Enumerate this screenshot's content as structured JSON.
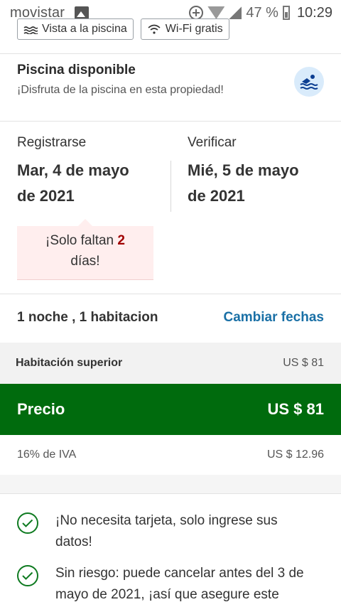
{
  "status_bar": {
    "carrier": "movistar",
    "battery_percent": "47 %",
    "time": "10:29"
  },
  "amenities": [
    {
      "label": "Vista a la piscina",
      "icon": "pool-icon"
    },
    {
      "label": "Wi-Fi gratis",
      "icon": "wifi-icon"
    }
  ],
  "pool": {
    "title": "Piscina disponible",
    "subtitle": "¡Disfruta de la piscina en esta propiedad!",
    "icon": "swimmer-icon"
  },
  "checkin": {
    "label": "Registrarse",
    "line1": "Mar, 4 de mayo",
    "line2": "de 2021"
  },
  "checkout": {
    "label": "Verificar",
    "line1": "Mié, 5 de mayo",
    "line2": "de 2021"
  },
  "alert": {
    "prefix": "¡Solo faltan ",
    "number": "2",
    "suffix": "días!"
  },
  "stay": {
    "summary": "1 noche , 1 habitacion",
    "change_link": "Cambiar fechas"
  },
  "pricing": {
    "room_name": "Habitación superior",
    "room_price": "US $ 81",
    "total_label": "Precio",
    "total_value": "US $ 81",
    "tax_label": "16% de IVA",
    "tax_value": "US $ 12.96",
    "accent_color": "#006b0d"
  },
  "benefits": [
    "¡No necesita tarjeta, solo ingrese sus datos!",
    "Sin riesgo: puede cancelar antes del 3 de mayo de 2021, ¡así que asegure este"
  ]
}
